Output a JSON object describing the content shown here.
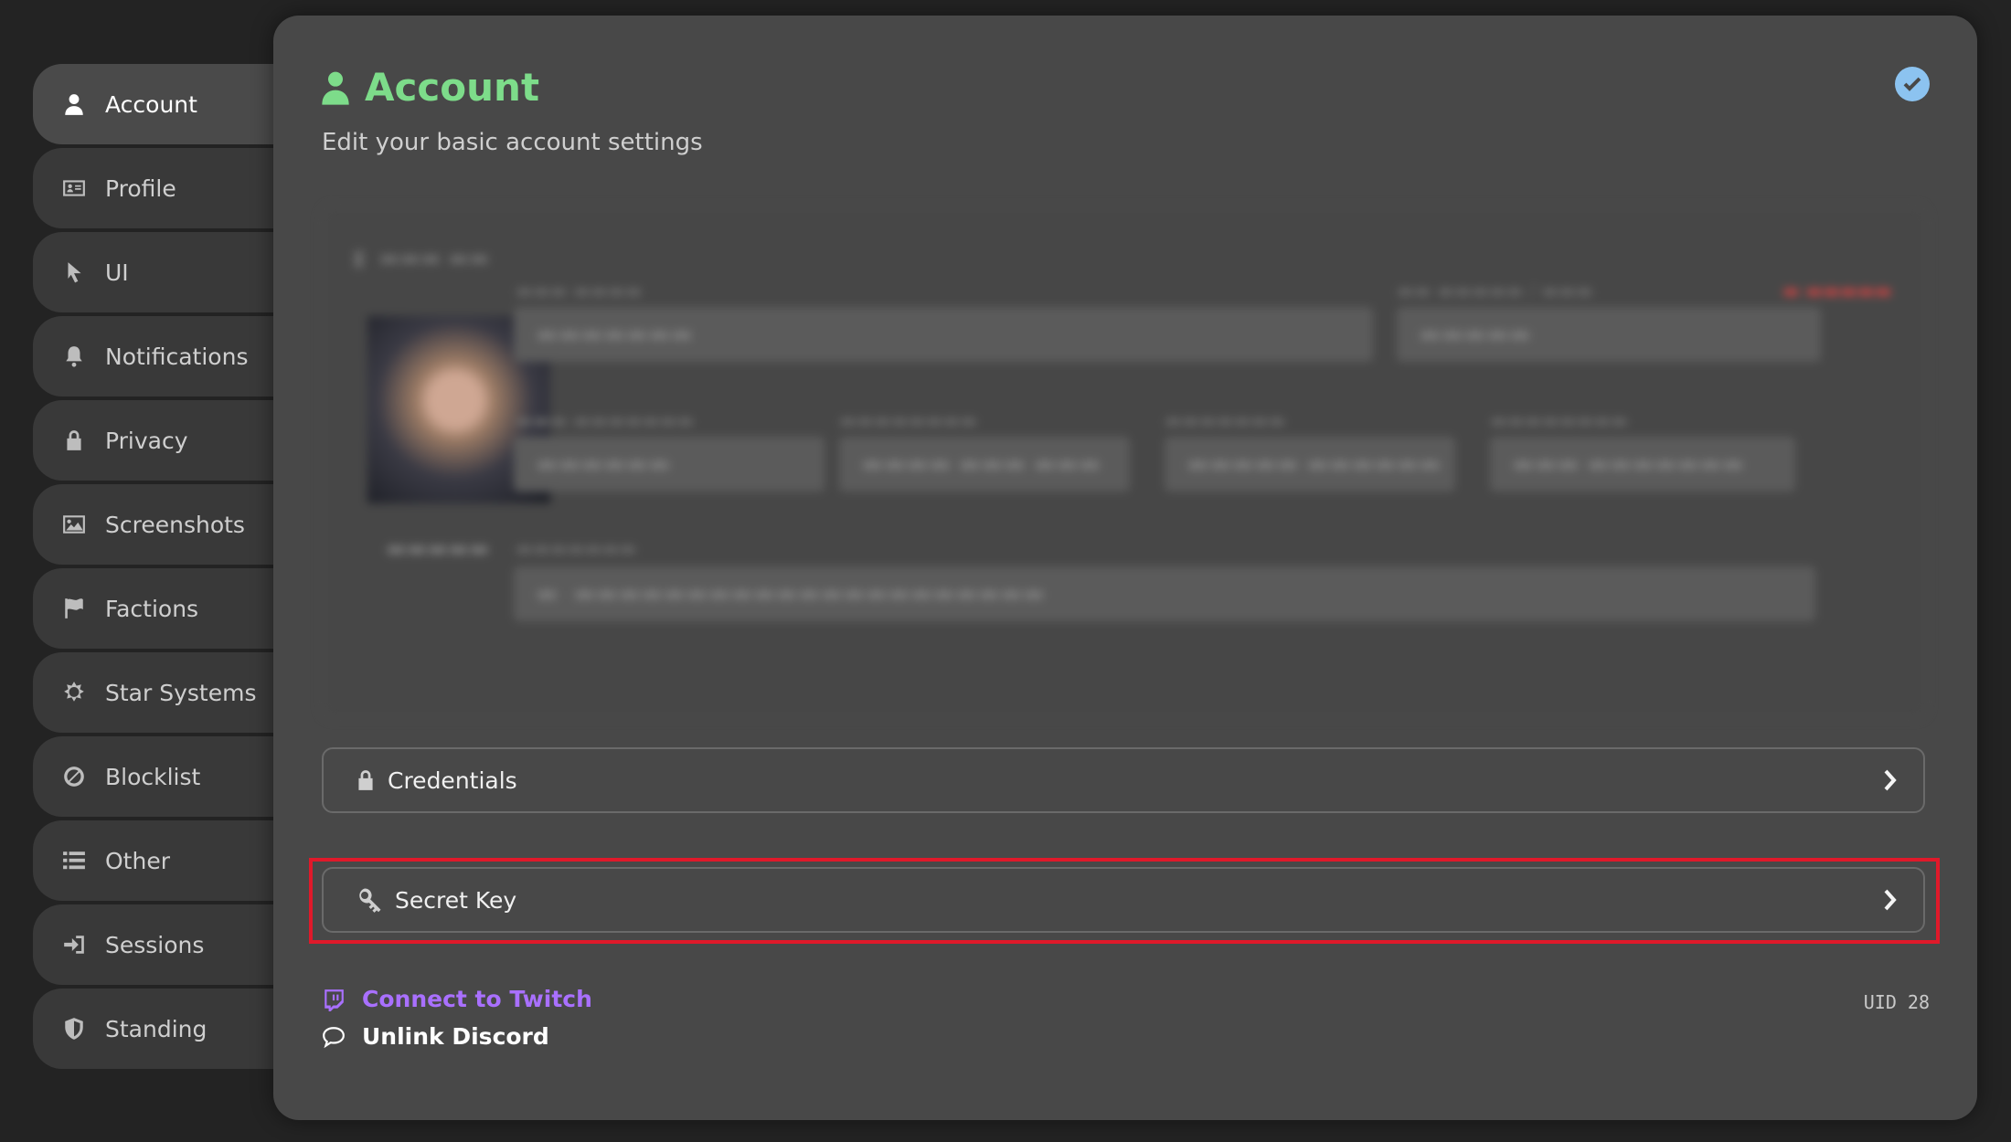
{
  "sidebar": {
    "items": [
      {
        "label": "Account",
        "icon": "user-icon",
        "active": true
      },
      {
        "label": "Profile",
        "icon": "id-card-icon"
      },
      {
        "label": "UI",
        "icon": "cursor-icon"
      },
      {
        "label": "Notifications",
        "icon": "bell-icon"
      },
      {
        "label": "Privacy",
        "icon": "lock-icon"
      },
      {
        "label": "Screenshots",
        "icon": "image-icon"
      },
      {
        "label": "Factions",
        "icon": "flag-icon"
      },
      {
        "label": "Star Systems",
        "icon": "sun-icon"
      },
      {
        "label": "Blocklist",
        "icon": "ban-icon"
      },
      {
        "label": "Other",
        "icon": "list-icon"
      },
      {
        "label": "Sessions",
        "icon": "sign-in-icon"
      },
      {
        "label": "Standing",
        "icon": "shield-icon"
      }
    ]
  },
  "header": {
    "title": "Account",
    "subtitle": "Edit your basic account settings"
  },
  "sections": {
    "credentials": {
      "label": "Credentials"
    },
    "secret_key": {
      "label": "Secret Key"
    }
  },
  "links": {
    "twitch": "Connect to Twitch",
    "discord": "Unlink Discord"
  },
  "uid": "UID 28",
  "colors": {
    "accent_green": "#7ddc8a",
    "twitch_purple": "#a970ff",
    "highlight_red": "#e0192a",
    "check_blue": "#8cc3f0"
  }
}
